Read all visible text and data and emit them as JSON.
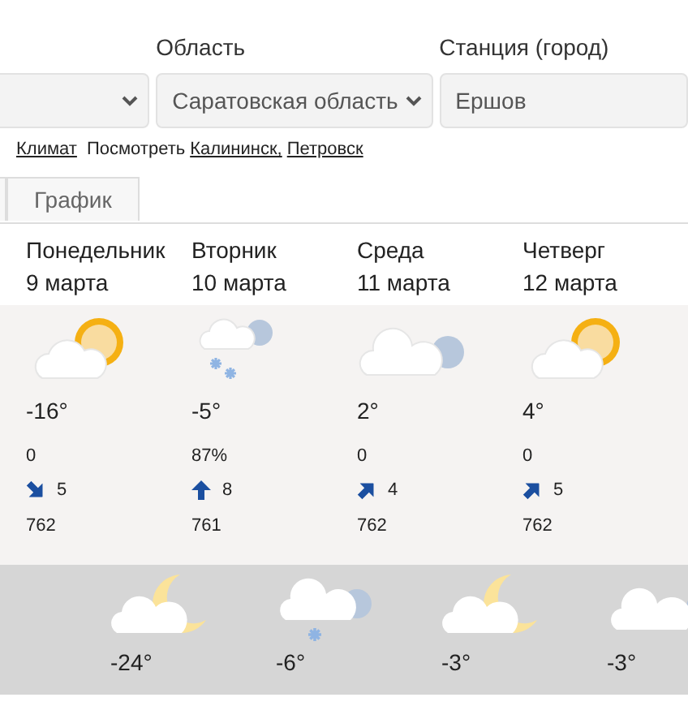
{
  "filters": [
    {
      "kind": "select"
    },
    {
      "kind": "select",
      "label": "Область",
      "value": "Саратовская область"
    },
    {
      "kind": "input",
      "label": "Станция (город)",
      "value": "Ершов"
    }
  ],
  "links": {
    "climate": "Климат",
    "see": "Посмотреть",
    "cities": [
      "Калининск,",
      "Петровск"
    ]
  },
  "tabs": [
    {
      "kind": "cut"
    },
    {
      "kind": "tab",
      "label": "График"
    }
  ],
  "days": [
    {
      "weekday": "Понедельник",
      "date": "9 марта",
      "kind": "sun-cloud",
      "temp": "-16°",
      "precip": "0",
      "wind": {
        "kind": "se",
        "speed": "5"
      },
      "pressure": "762"
    },
    {
      "weekday": "Вторник",
      "date": "10 марта",
      "kind": "snow-cloud",
      "temp": "-5°",
      "precip": "87%",
      "wind": {
        "kind": "n",
        "speed": "8"
      },
      "pressure": "761"
    },
    {
      "weekday": "Среда",
      "date": "11 марта",
      "kind": "cloudy",
      "temp": "2°",
      "precip": "0",
      "wind": {
        "kind": "ne",
        "speed": "4"
      },
      "pressure": "762"
    },
    {
      "weekday": "Четверг",
      "date": "12 марта",
      "kind": "sun-cloud",
      "temp": "4°",
      "precip": "0",
      "wind": {
        "kind": "ne",
        "speed": "5"
      },
      "pressure": "762"
    }
  ],
  "nights": [
    {
      "kind": "moon-cloud",
      "temp": "-24°"
    },
    {
      "kind": "snow-cloud",
      "temp": "-6°"
    },
    {
      "kind": "moon-cloud",
      "temp": "-3°"
    },
    {
      "kind": "cloud",
      "temp": "-3°"
    }
  ]
}
